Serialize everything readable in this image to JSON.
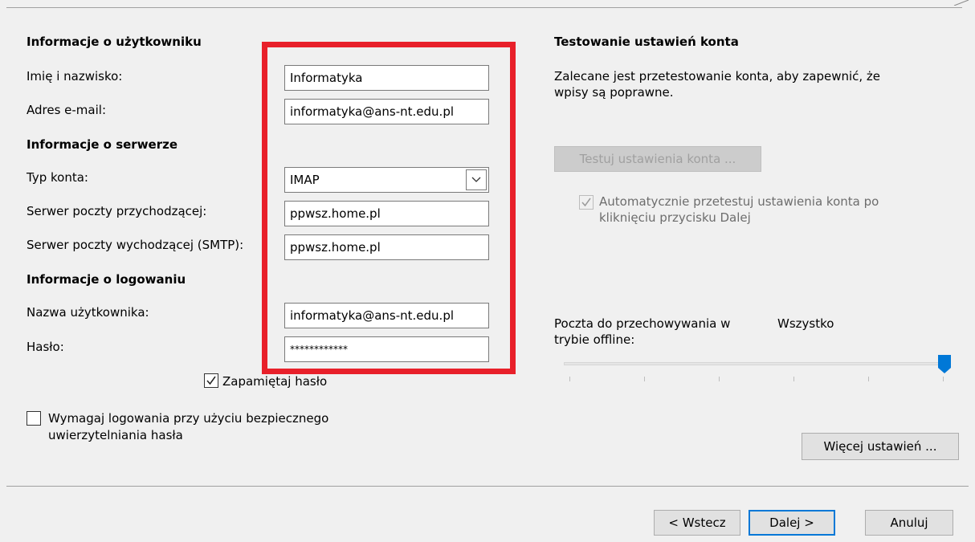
{
  "user_info": {
    "title": "Informacje o użytkowniku",
    "name_label": "Imię i nazwisko:",
    "name_value": "Informatyka",
    "email_label": "Adres e-mail:",
    "email_value": "informatyka@ans-nt.edu.pl"
  },
  "server_info": {
    "title": "Informacje o serwerze",
    "account_type_label": "Typ konta:",
    "account_type_value": "IMAP",
    "incoming_label": "Serwer poczty przychodzącej:",
    "incoming_value": "ppwsz.home.pl",
    "outgoing_label": "Serwer poczty wychodzącej (SMTP):",
    "outgoing_value": "ppwsz.home.pl"
  },
  "login_info": {
    "title": "Informacje o logowaniu",
    "username_label": "Nazwa użytkownika:",
    "username_value": "informatyka@ans-nt.edu.pl",
    "password_label": "Hasło:",
    "password_value": "************",
    "remember_label": "Zapamiętaj hasło",
    "remember_checked": true,
    "spa_label_line1": "Wymagaj logowania przy użyciu bezpiecznego",
    "spa_label_line2": "uwierzytelniania hasła",
    "spa_checked": false
  },
  "test": {
    "title": "Testowanie ustawień konta",
    "description_line1": "Zalecane jest przetestowanie konta, aby zapewnić, że",
    "description_line2": "wpisy są poprawne.",
    "test_button": "Testuj ustawienia konta ...",
    "auto_test_line1": "Automatycznie przetestuj ustawienia konta po",
    "auto_test_line2": "kliknięciu przycisku Dalej",
    "auto_test_checked": true
  },
  "offline": {
    "label_line1": "Poczta do przechowywania w",
    "label_line2": "trybie offline:",
    "value": "Wszystko",
    "slider_fraction": 1.0
  },
  "buttons": {
    "more_settings": "Więcej ustawień ...",
    "back": "< Wstecz",
    "next": "Dalej >",
    "cancel": "Anuluj"
  },
  "colors": {
    "highlight_box": "#e8202a",
    "accent": "#0078d7"
  }
}
